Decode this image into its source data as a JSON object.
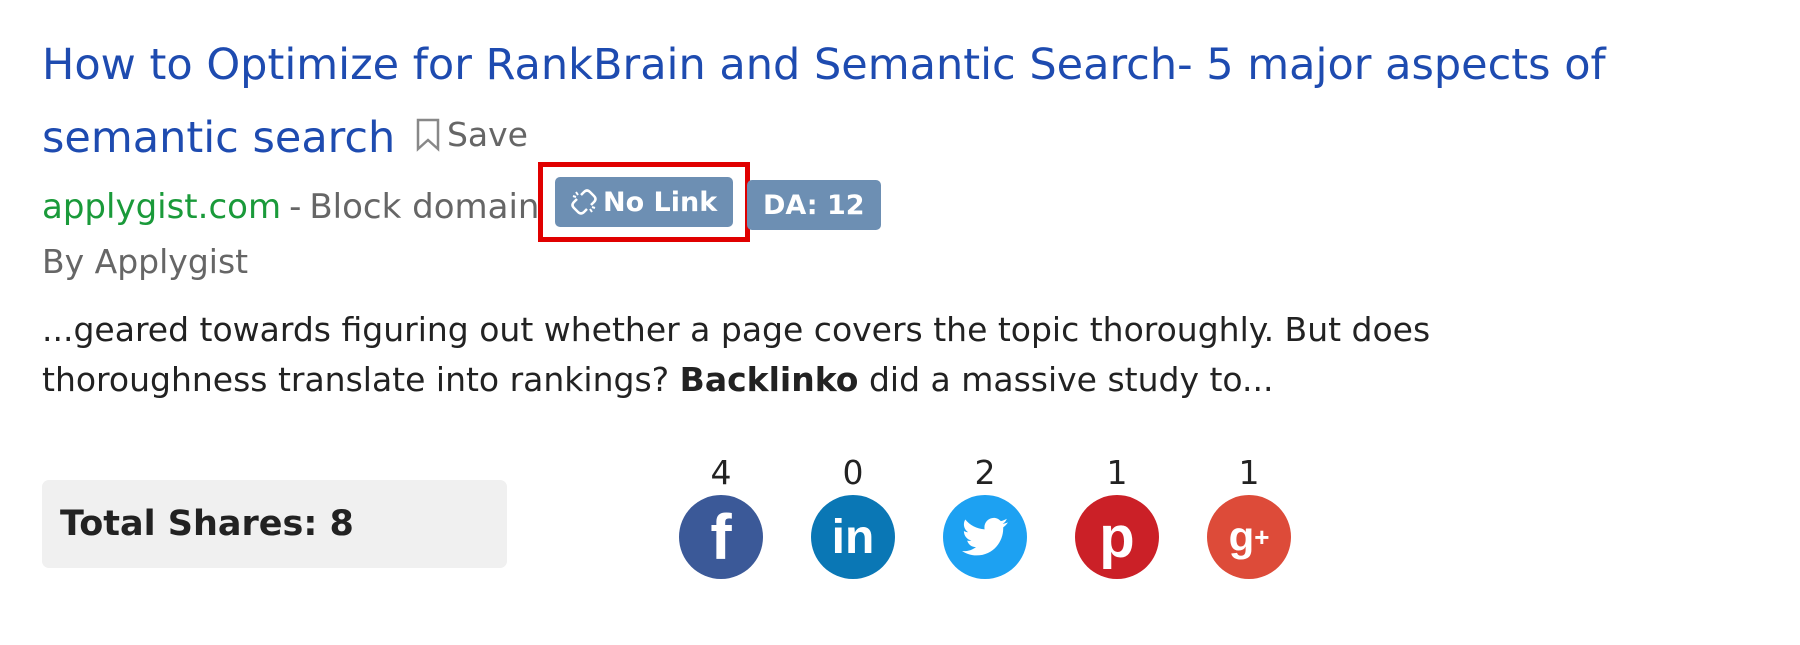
{
  "result": {
    "title": "How to Optimize for RankBrain and Semantic Search- 5 major aspects of semantic search",
    "save_label": "Save",
    "domain": "applygist.com",
    "separator": "-",
    "block_domain_label": "Block domain",
    "no_link_badge": "No Link",
    "da_badge": "DA: 12",
    "author": "By Applygist",
    "snippet_before": "...geared towards figuring out whether a page covers the topic thoroughly. But does thoroughness translate into rankings?",
    "snippet_bold": "Backlinko",
    "snippet_after": "did a massive study to...",
    "highlight_color": "#e00000"
  },
  "shares": {
    "total_label": "Total Shares: 8",
    "networks": [
      {
        "name": "facebook",
        "count": "4",
        "icon": "facebook-icon",
        "color": "#3b5998"
      },
      {
        "name": "linkedin",
        "count": "0",
        "icon": "linkedin-icon",
        "color": "#0a77b5"
      },
      {
        "name": "twitter",
        "count": "2",
        "icon": "twitter-icon",
        "color": "#1da1f2"
      },
      {
        "name": "pinterest",
        "count": "1",
        "icon": "pinterest-icon",
        "color": "#cb2027"
      },
      {
        "name": "google-plus",
        "count": "1",
        "icon": "google-plus-icon",
        "color": "#dd4b39"
      }
    ]
  }
}
